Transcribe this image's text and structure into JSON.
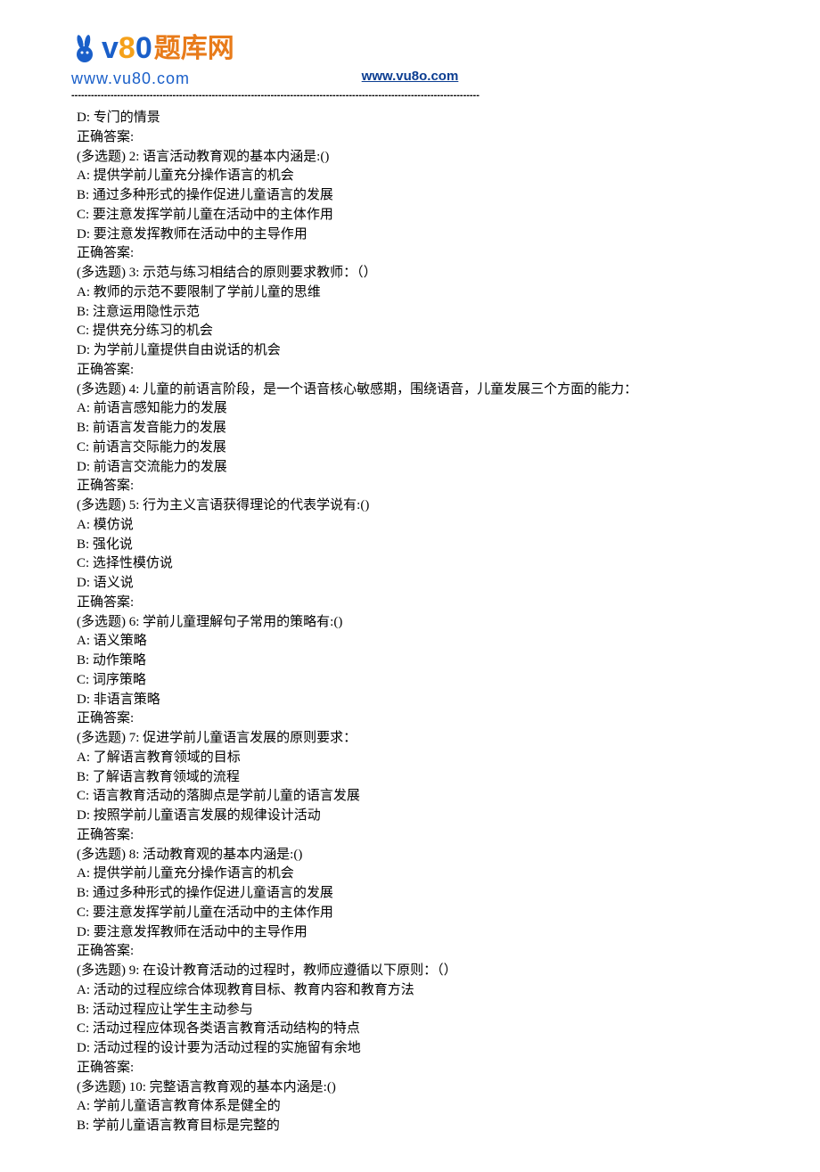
{
  "header": {
    "logo_v": "v",
    "logo_8": "8",
    "logo_0": "0",
    "logo_cn": "题库网",
    "logo_sub": "www.vu80.com",
    "link": "www.vu8o.com",
    "divider": "-----------------------------------------------------------------------------------------------------------------------------"
  },
  "lines": [
    "D: 专门的情景",
    "正确答案:",
    "(多选题) 2: 语言活动教育观的基本内涵是:()",
    "A: 提供学前儿童充分操作语言的机会",
    "B: 通过多种形式的操作促进儿童语言的发展",
    "C: 要注意发挥学前儿童在活动中的主体作用",
    "D: 要注意发挥教师在活动中的主导作用",
    "正确答案:",
    "(多选题) 3: 示范与练习相结合的原则要求教师：（）",
    "A: 教师的示范不要限制了学前儿童的思维",
    "B: 注意运用隐性示范",
    "C: 提供充分练习的机会",
    "D: 为学前儿童提供自由说话的机会",
    "正确答案:",
    "(多选题) 4: 儿童的前语言阶段，是一个语音核心敏感期，围绕语音，儿童发展三个方面的能力：",
    "A: 前语言感知能力的发展",
    "B: 前语言发音能力的发展",
    "C: 前语言交际能力的发展",
    "D: 前语言交流能力的发展",
    "正确答案:",
    "(多选题) 5: 行为主义言语获得理论的代表学说有:()",
    "A: 模仿说",
    "B: 强化说",
    "C: 选择性模仿说",
    "D: 语义说",
    "正确答案:",
    "(多选题) 6: 学前儿童理解句子常用的策略有:()",
    "A: 语义策略",
    "B: 动作策略",
    "C: 词序策略",
    "D: 非语言策略",
    "正确答案:",
    "(多选题) 7: 促进学前儿童语言发展的原则要求：",
    "A: 了解语言教育领域的目标",
    "B: 了解语言教育领域的流程",
    "C: 语言教育活动的落脚点是学前儿童的语言发展",
    "D: 按照学前儿童语言发展的规律设计活动",
    "正确答案:",
    "(多选题) 8: 活动教育观的基本内涵是:()",
    "A: 提供学前儿童充分操作语言的机会",
    "B: 通过多种形式的操作促进儿童语言的发展",
    "C: 要注意发挥学前儿童在活动中的主体作用",
    "D: 要注意发挥教师在活动中的主导作用",
    "正确答案:",
    "(多选题) 9: 在设计教育活动的过程时，教师应遵循以下原则：（）",
    "A: 活动的过程应综合体现教育目标、教育内容和教育方法",
    "B: 活动过程应让学生主动参与",
    "C: 活动过程应体现各类语言教育活动结构的特点",
    "D: 活动过程的设计要为活动过程的实施留有余地",
    "正确答案:",
    "(多选题) 10: 完整语言教育观的基本内涵是:()",
    "A: 学前儿童语言教育体系是健全的",
    "B: 学前儿童语言教育目标是完整的"
  ]
}
